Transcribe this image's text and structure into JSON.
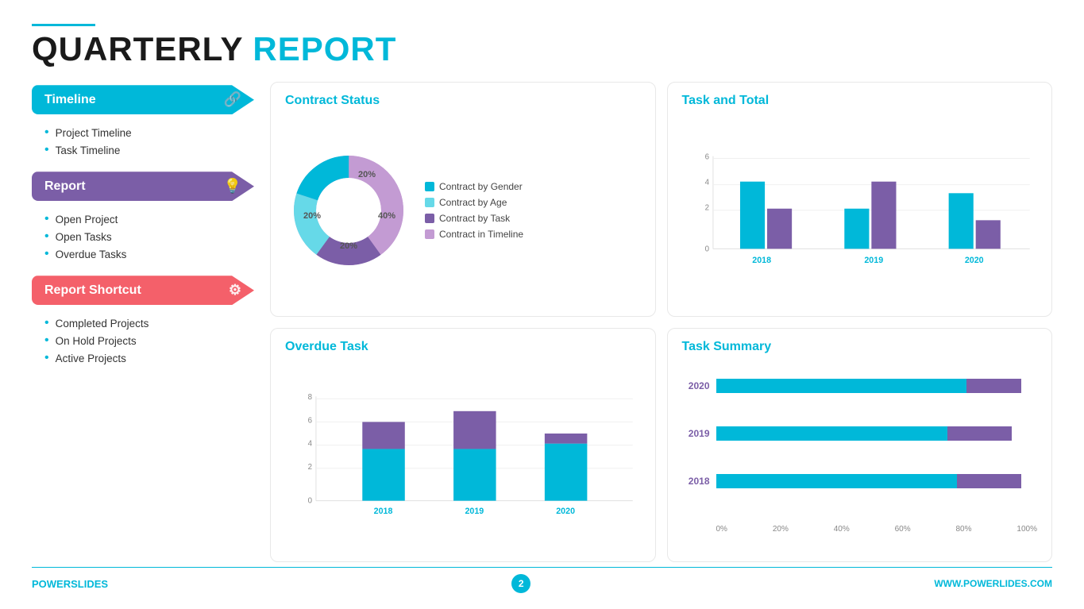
{
  "header": {
    "line_color": "#00b8d9",
    "title_black": "QUARTERLY",
    "title_blue": "REPORT"
  },
  "sidebar": {
    "sections": [
      {
        "id": "timeline",
        "label": "Timeline",
        "color": "cyan",
        "icon": "🔗",
        "items": [
          "Project Timeline",
          "Task Timeline"
        ]
      },
      {
        "id": "report",
        "label": "Report",
        "color": "purple",
        "icon": "💡",
        "items": [
          "Open Project",
          "Open Tasks",
          "Overdue Tasks"
        ]
      },
      {
        "id": "report-shortcut",
        "label": "Report Shortcut",
        "color": "red",
        "icon": "⚙",
        "items": [
          "Completed Projects",
          "On Hold Projects",
          "Active Projects"
        ]
      }
    ]
  },
  "contract_status": {
    "title": "Contract Status",
    "segments": [
      {
        "label": "Contract by Gender",
        "color": "#00b8d9",
        "value": 20,
        "percent": "20%",
        "offset": 0
      },
      {
        "label": "Contract by Age",
        "color": "#66d9e8",
        "value": 20,
        "percent": "20%"
      },
      {
        "label": "Contract by Task",
        "color": "#7b5ea7",
        "value": 20,
        "percent": "20%"
      },
      {
        "label": "Contract in Timeline",
        "color": "#c39bd3",
        "value": 40,
        "percent": "40%"
      }
    ]
  },
  "task_and_total": {
    "title": "Task and Total",
    "years": [
      "2018",
      "2019",
      "2020"
    ],
    "y_max": 6,
    "y_labels": [
      "6",
      "4",
      "2",
      "0"
    ],
    "bars": [
      {
        "year": "2018",
        "cyan": 4,
        "purple": 2.5
      },
      {
        "year": "2019",
        "cyan": 2.5,
        "purple": 4.2
      },
      {
        "year": "2020",
        "cyan": 3.5,
        "purple": 1.8
      }
    ]
  },
  "overdue_task": {
    "title": "Overdue Task",
    "years": [
      "2018",
      "2019",
      "2020"
    ],
    "y_max": 8,
    "y_labels": [
      "8",
      "6",
      "4",
      "2",
      "0"
    ],
    "bars": [
      {
        "year": "2018",
        "cyan": 4,
        "purple": 2.5
      },
      {
        "year": "2019",
        "cyan": 4,
        "purple": 3
      },
      {
        "year": "2020",
        "cyan": 4.5,
        "purple": 0.8
      }
    ]
  },
  "task_summary": {
    "title": "Task Summary",
    "rows": [
      {
        "year": "2020",
        "cyan_pct": 78,
        "purple_pct": 17
      },
      {
        "year": "2019",
        "cyan_pct": 72,
        "purple_pct": 20
      },
      {
        "year": "2018",
        "cyan_pct": 75,
        "purple_pct": 20
      }
    ],
    "x_labels": [
      "0%",
      "20%",
      "40%",
      "60%",
      "80%",
      "100%"
    ]
  },
  "footer": {
    "brand_black": "POWER",
    "brand_blue": "SLIDES",
    "page_number": "2",
    "website": "WWW.POWERLIDES.COM"
  }
}
